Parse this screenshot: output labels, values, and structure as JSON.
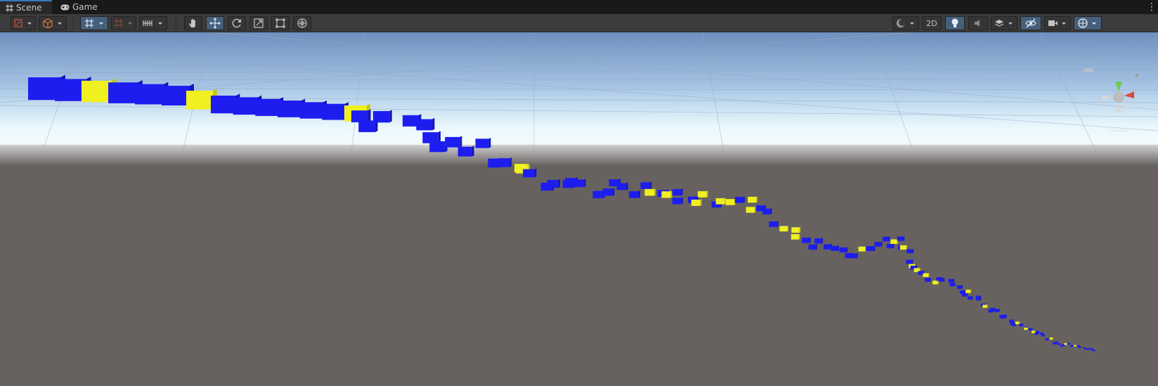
{
  "tabs": [
    {
      "label": "Scene",
      "icon": "grid-icon",
      "active": true
    },
    {
      "label": "Game",
      "icon": "gamepad-icon",
      "active": false
    }
  ],
  "toolbar": {
    "mode_2d_label": "2D",
    "left_tools": [
      "draw-mode-icon",
      "cube-icon",
      "grid-snap-icon",
      "increment-snap-icon",
      "ruler-icon"
    ],
    "transform_tools": [
      "hand-icon",
      "move-icon",
      "rotate-icon",
      "scale-icon",
      "rect-icon",
      "transform-icon"
    ],
    "right_tools": [
      "shading-icon",
      "lighting-icon",
      "audio-icon",
      "effects-icon",
      "hidden-icon",
      "camera-icon",
      "gizmos-icon"
    ]
  },
  "scene": {
    "sky_top_color": "#6f8fbd",
    "sky_horizon_color": "#f0fbff",
    "ground_color": "#676260",
    "cube_colors": {
      "blue": "#1d1df0",
      "yellow": "#f0f020"
    }
  }
}
